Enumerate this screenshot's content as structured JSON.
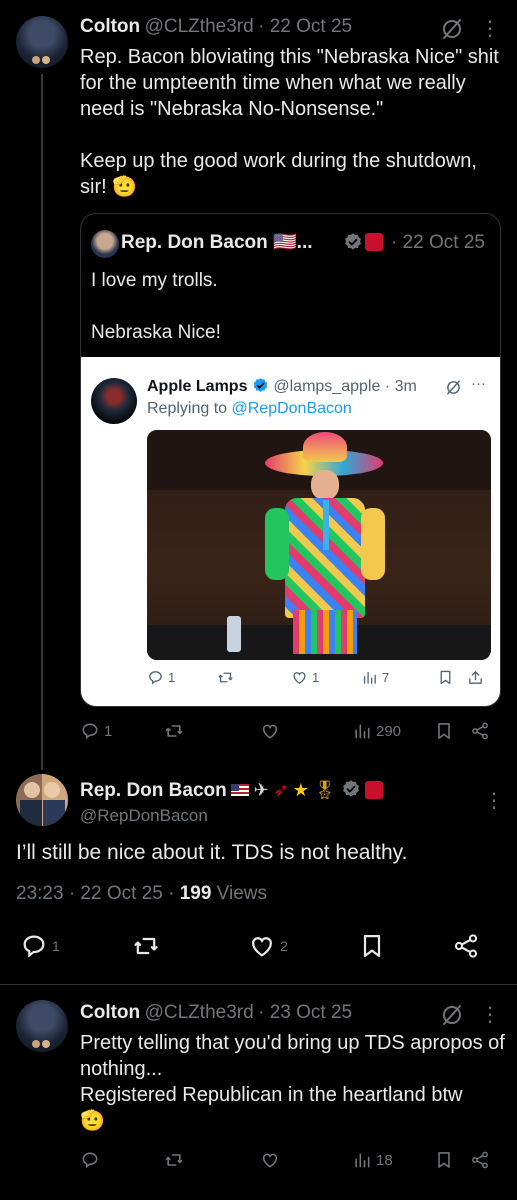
{
  "post1": {
    "name": "Colton",
    "handle": "@CLZthe3rd",
    "time": "· 22 Oct 25",
    "text": "Rep. Bacon bloviating this \"Nebraska Nice\" shit for the umpteenth time when what we really need is \"Nebraska No-Nonsense.\"\n\nKeep up the good work during the shutdown, sir! 🫡",
    "actions": {
      "replies": "1",
      "views": "290"
    }
  },
  "quote": {
    "name": "Rep. Don Bacon 🇺🇸...",
    "time": "· 22 Oct 25",
    "text": "I love my trolls.\n\nNebraska Nice!",
    "embedded": {
      "name": "Apple Lamps",
      "handle": "@lamps_apple",
      "time": "· 3m",
      "replying_prefix": "Replying to ",
      "replying_handle": "@RepDonBacon",
      "replies": "1",
      "likes": "1",
      "views": "7"
    }
  },
  "main": {
    "name": "Rep. Don Bacon",
    "handle": "@RepDonBacon",
    "text": "I’ll still be nice about it. TDS is not healthy.",
    "timestamp": "23:23 · 22 Oct 25 · ",
    "views_count": "199",
    "views_label": " Views",
    "replies": "1",
    "likes": "2"
  },
  "reply": {
    "name": "Colton",
    "handle": "@CLZthe3rd",
    "time": "· 23 Oct 25",
    "text": "Pretty telling that you'd bring up TDS apropos of nothing...\nRegistered Republican in the heartland btw\n🫡",
    "views": "18"
  },
  "icons": {
    "reply": "reply-icon",
    "repost": "repost-icon",
    "like": "like-icon",
    "views": "views-icon",
    "bookmark": "bookmark-icon",
    "share": "share-icon",
    "grok": "grok-icon",
    "more": "more-icon"
  },
  "colors": {
    "bg": "#000000",
    "text": "#e7e9ea",
    "muted": "#71767b",
    "link": "#1d9bf0",
    "divider": "#2f3336"
  }
}
